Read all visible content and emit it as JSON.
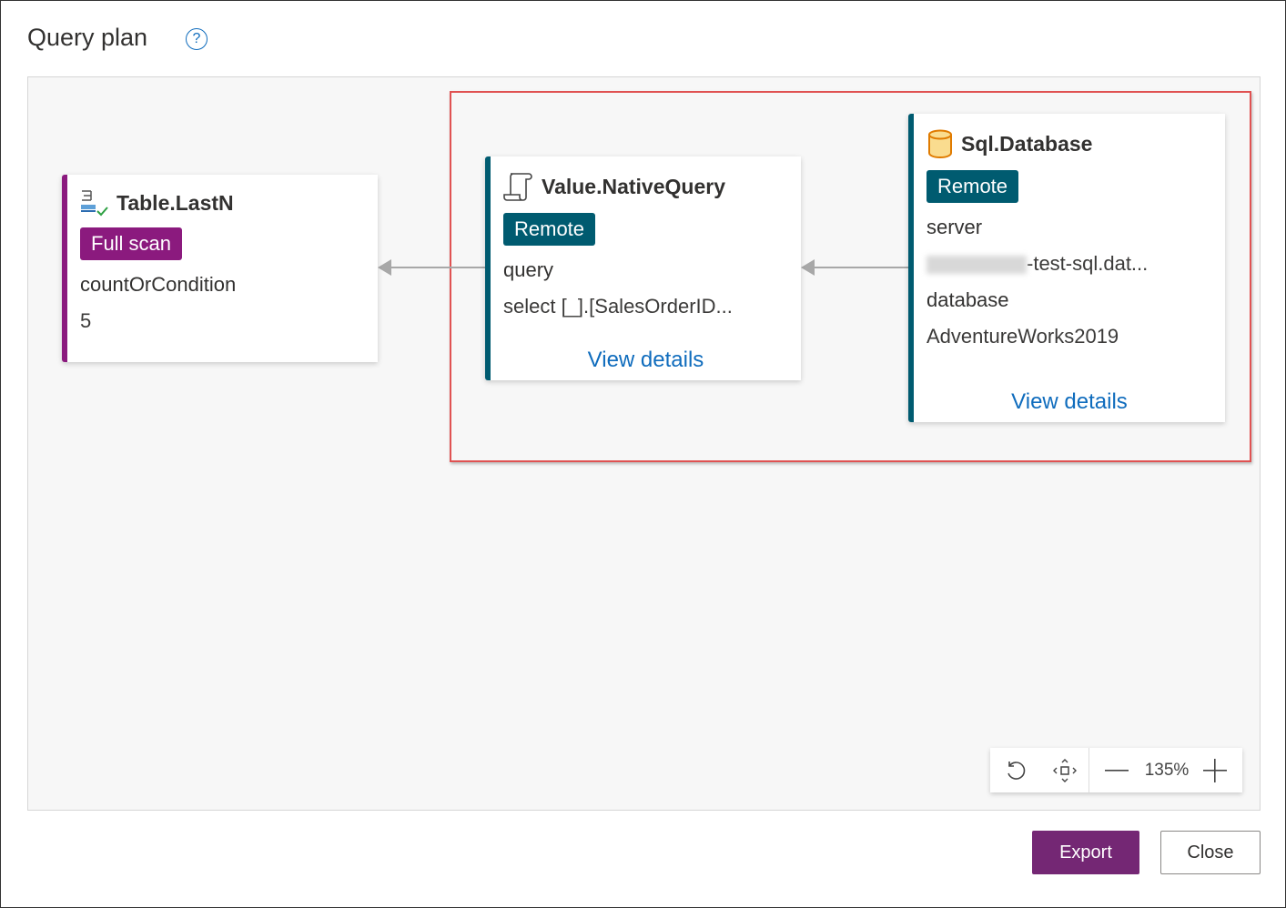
{
  "dialog": {
    "title": "Query plan",
    "help_icon": "?"
  },
  "nodes": [
    {
      "title": "Table.LastN",
      "badge": "Full scan",
      "param_label": "countOrCondition",
      "param_value": "5",
      "color": "#8b1a7e"
    },
    {
      "title": "Value.NativeQuery",
      "badge": "Remote",
      "param_label": "query",
      "param_value": "select [_].[SalesOrderID...",
      "link": "View details",
      "color": "#005b70"
    },
    {
      "title": "Sql.Database",
      "badge": "Remote",
      "param1_label": "server",
      "param1_value": "-test-sql.dat...",
      "param2_label": "database",
      "param2_value": "AdventureWorks2019",
      "link": "View details",
      "color": "#005b70"
    }
  ],
  "zoom": {
    "level": "135%"
  },
  "footer": {
    "export": "Export",
    "close": "Close"
  }
}
